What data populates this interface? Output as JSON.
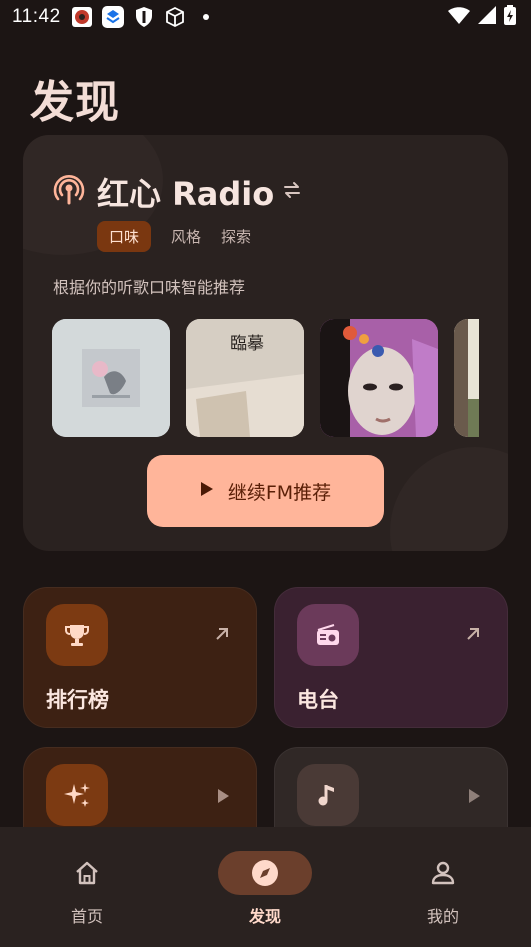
{
  "status_bar": {
    "time": "11:42"
  },
  "page": {
    "title": "发现"
  },
  "radio": {
    "title": "红心 Radio",
    "tabs": [
      {
        "label": "口味",
        "active": true
      },
      {
        "label": "风格",
        "active": false
      },
      {
        "label": "探索",
        "active": false
      }
    ],
    "description": "根据你的听歌口味智能推荐",
    "cover_text_2": "臨摹",
    "play_label": "继续FM推荐"
  },
  "tiles": [
    {
      "label": "排行榜",
      "icon": "trophy-icon"
    },
    {
      "label": "电台",
      "icon": "radio-icon"
    },
    {
      "label": "",
      "icon": "sparkles-icon"
    },
    {
      "label": "",
      "icon": "music-note-icon"
    }
  ],
  "nav": [
    {
      "label": "首页",
      "icon": "home-icon",
      "active": false
    },
    {
      "label": "发现",
      "icon": "compass-icon",
      "active": true
    },
    {
      "label": "我的",
      "icon": "person-icon",
      "active": false
    }
  ],
  "colors": {
    "background": "#1c1514",
    "card": "#2a2220",
    "accent": "#ffb59a",
    "chip_active": "#7a3710",
    "tile_brown": "#3d2113",
    "tile_purple": "#3a2130"
  }
}
